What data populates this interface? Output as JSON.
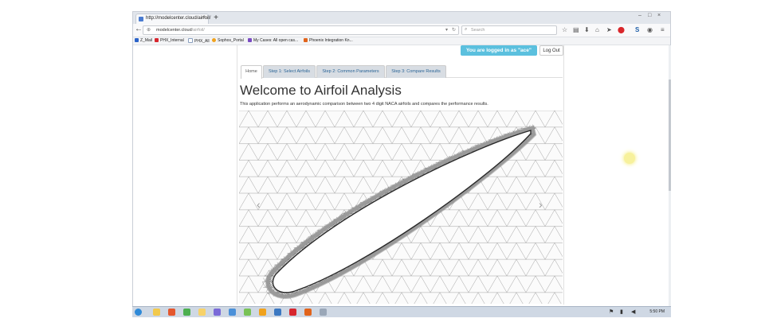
{
  "browser": {
    "tab_title": "http://modelcenter.cloud/airfoil/",
    "new_tab": "+",
    "address_host": "modelcenter.cloud",
    "address_path": "/airfoil/",
    "search_placeholder": "Search",
    "window_controls": [
      "–",
      "□",
      "×"
    ],
    "bookmarks": [
      {
        "label": "Z_Mail",
        "color": "#2b63c9"
      },
      {
        "label": "PHX_Internal",
        "color": "#d7262e"
      },
      {
        "label": "PHX_All",
        "color": "#5f7fa8"
      },
      {
        "label": "Sophos_Portal",
        "color": "#f0a21e"
      },
      {
        "label": "My Cases: All open cas...",
        "color": "#7a4bc2"
      },
      {
        "label": "Phoenix Integration Kn...",
        "color": "#e1641c"
      }
    ]
  },
  "page": {
    "login_status": "You are logged in as \"ace\"",
    "logout_label": "Log Out",
    "tabs": [
      {
        "label": "Home",
        "active": true
      },
      {
        "label": "Step 1: Select Airfoils",
        "active": false
      },
      {
        "label": "Step 2: Common Parameters",
        "active": false
      },
      {
        "label": "Step 3: Compare Results",
        "active": false
      }
    ],
    "title": "Welcome to Airfoil Analysis",
    "intro": "This application performs an aerodynamic comparison between two 4 digit NACA airfoils and compares the performance results.",
    "carousel_prev": "‹",
    "carousel_next": "›"
  },
  "taskbar": {
    "clock": "5:50 PM"
  },
  "colors": {
    "accent_info": "#5bc0de",
    "tab_link": "#2a6496",
    "airfoil_outline": "#2a2a2a",
    "mesh": "#6f6f6f"
  },
  "icons": [
    "back-arrow-icon",
    "reload-icon",
    "search-icon",
    "star-icon",
    "clipboard-icon",
    "download-icon",
    "home-icon",
    "send-icon",
    "stop-icon",
    "s-icon",
    "menu-icon"
  ]
}
